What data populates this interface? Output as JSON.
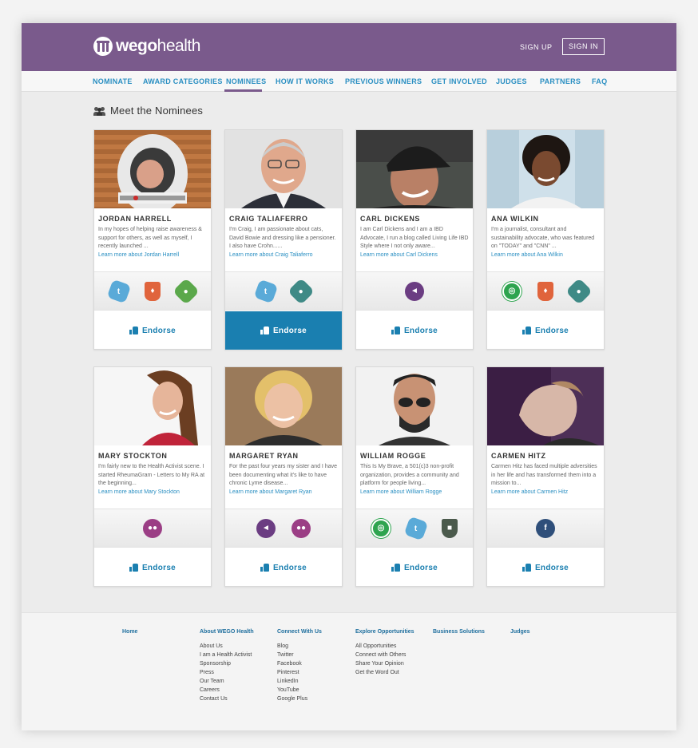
{
  "header": {
    "logo_bold": "wego",
    "logo_light": "health",
    "signup": "SIGN UP",
    "signin": "SIGN IN",
    "background": "#7a5a8c"
  },
  "nav": {
    "items": [
      "NOMINATE",
      "AWARD CATEGORIES",
      "NOMINEES",
      "HOW IT WORKS",
      "PREVIOUS WINNERS",
      "GET INVOLVED",
      "JUDGES",
      "PARTNERS",
      "FAQ"
    ],
    "active": "NOMINEES"
  },
  "section_title": "Meet the Nominees",
  "cards": [
    {
      "name": "JORDAN HARRELL",
      "bio": "In my hopes of helping raise awareness & support for others, as well as myself, I recently launched ...",
      "learn": "Learn more about Jordan Harrell",
      "badges": [
        "twitter",
        "ribbon",
        "community"
      ],
      "endorse": "Endorse",
      "endorse_active": false
    },
    {
      "name": "CRAIG TALIAFERRO",
      "bio": "I'm Craig, I am passionate about cats, David Bowie and dressing like a pensioner. I also have Crohn......",
      "learn": "Learn more about Craig Taliaferro",
      "badges": [
        "twitter",
        "gear"
      ],
      "endorse": "Endorse",
      "endorse_active": true
    },
    {
      "name": "CARL DICKENS",
      "bio": "I am Carl Dickens and I am a IBD Advocate, I run a blog called Living Life IBD Style where I not only aware...",
      "learn": "Learn more about Carl Dickens",
      "badges": [
        "megaphone"
      ],
      "endorse": "Endorse",
      "endorse_active": false
    },
    {
      "name": "ANA WILKIN",
      "bio": "I'm a journalist, consultant and sustainability advocate, who was featured on \"TODAY\" and \"CNN\" ...",
      "learn": "Learn more about Ana Wilkin",
      "badges": [
        "laurel",
        "ribbon",
        "gear"
      ],
      "endorse": "Endorse",
      "endorse_active": false
    },
    {
      "name": "MARY STOCKTON",
      "bio": "I'm fairly new to the Health Activist scene. I started RheumaGram - Letters to My RA at the beginning...",
      "learn": "Learn more about Mary Stockton",
      "badges": [
        "chat"
      ],
      "endorse": "Endorse",
      "endorse_active": false
    },
    {
      "name": "MARGARET RYAN",
      "bio": "For the past four years my sister and I have been documenting what it's like to have chronic Lyme disease...",
      "learn": "Learn more about Margaret Ryan",
      "badges": [
        "megaphone",
        "chat"
      ],
      "endorse": "Endorse",
      "endorse_active": false
    },
    {
      "name": "WILLIAM ROGGE",
      "bio": "This Is My Brave, a 501(c)3 non-profit organization, provides a community and platform for people living...",
      "learn": "Learn more about William Rogge",
      "badges": [
        "laurel",
        "twitter",
        "shield"
      ],
      "endorse": "Endorse",
      "endorse_active": false
    },
    {
      "name": "CARMEN HITZ",
      "bio": "Carmen Hitz has faced multiple adversities in her life and has transformed them into a mission to...",
      "learn": "Learn more about Carmen Hitz",
      "badges": [
        "facebook"
      ],
      "endorse": "Endorse",
      "endorse_active": false
    }
  ],
  "footer": {
    "home": "Home",
    "about": {
      "title": "About WEGO Health",
      "links": [
        "About Us",
        "I am a Health Activist",
        "Sponsorship",
        "Press",
        "Our Team",
        "Careers",
        "Contact Us"
      ]
    },
    "connect": {
      "title": "Connect With Us",
      "links": [
        "Blog",
        "Twitter",
        "Facebook",
        "Pinterest",
        "LinkedIn",
        "YouTube",
        "Google Plus"
      ]
    },
    "explore": {
      "title": "Explore Opportunities",
      "links": [
        "All Opportunities",
        "Connect with Others",
        "Share Your Opinion",
        "Get the Word Out"
      ]
    },
    "business": "Business Solutions",
    "judges": "Judges"
  }
}
